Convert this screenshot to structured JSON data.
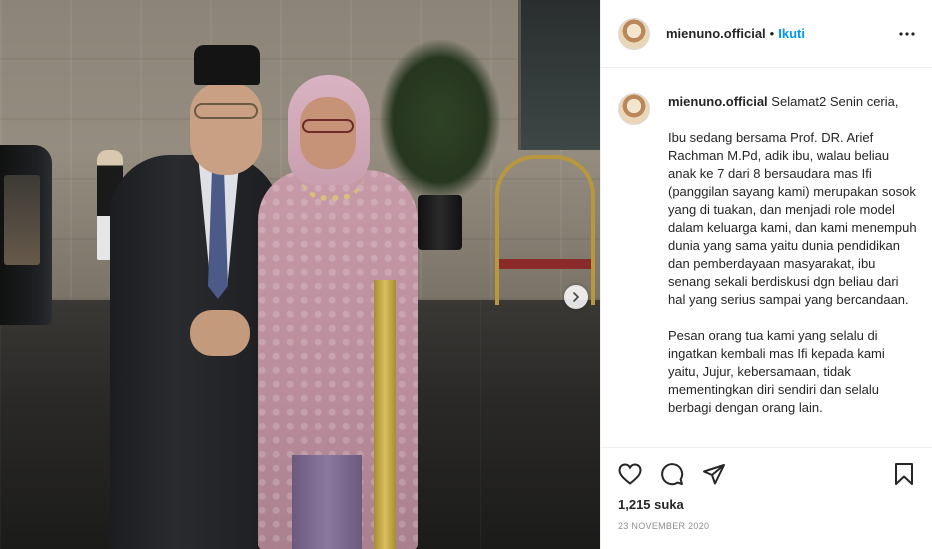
{
  "post": {
    "username": "mienuno.official",
    "separator": "•",
    "follow_label": "Ikuti",
    "caption_paragraphs": [
      "Selamat2 Senin ceria,",
      "Ibu sedang bersama Prof. DR. Arief Rachman M.Pd, adik ibu, walau beliau anak ke 7 dari 8 bersaudara mas Ifi (panggilan sayang kami) merupakan sosok yang di tuakan, dan menjadi role model dalam keluarga kami, dan kami menempuh dunia yang sama yaitu dunia pendidikan dan pemberdayaan masyarakat, ibu senang sekali berdiskusi dgn beliau dari hal yang serius sampai yang bercandaan.",
      "Pesan orang tua kami yang selalu di ingatkan kembali mas Ifi kepada kami yaitu, Jujur, kebersamaan, tidak mementingkan diri sendiri dan selalu berbagi dengan orang lain."
    ],
    "likes": "1,215 suka",
    "date": "23 NOVEMBER 2020"
  },
  "icons": {
    "more": "more-options-icon",
    "next": "chevron-right-icon",
    "like": "heart-icon",
    "comment": "comment-icon",
    "share": "send-icon",
    "save": "bookmark-icon"
  },
  "colors": {
    "link": "#0095f6",
    "text": "#262626",
    "muted": "#8e8e8e",
    "border": "#efefef"
  }
}
